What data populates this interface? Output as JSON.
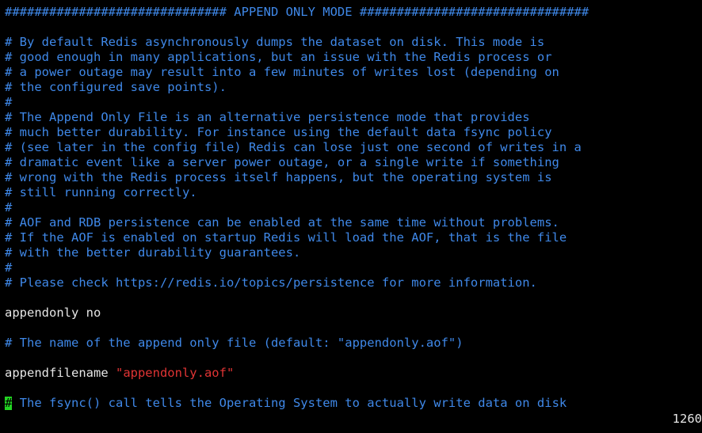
{
  "window": {
    "colors": {
      "background": "#000000",
      "comment": "#3f88e8",
      "text": "#e6e6e6",
      "string": "#e03434",
      "cursor": "#22d422"
    }
  },
  "editor": {
    "header": "############################## APPEND ONLY MODE ###############################",
    "comments": [
      "# By default Redis asynchronously dumps the dataset on disk. This mode is",
      "# good enough in many applications, but an issue with the Redis process or",
      "# a power outage may result into a few minutes of writes lost (depending on",
      "# the configured save points).",
      "#",
      "# The Append Only File is an alternative persistence mode that provides",
      "# much better durability. For instance using the default data fsync policy",
      "# (see later in the config file) Redis can lose just one second of writes in a",
      "# dramatic event like a server power outage, or a single write if something",
      "# wrong with the Redis process itself happens, but the operating system is",
      "# still running correctly.",
      "#",
      "# AOF and RDB persistence can be enabled at the same time without problems.",
      "# If the AOF is enabled on startup Redis will load the AOF, that is the file",
      "# with the better durability guarantees.",
      "#",
      "# Please check https://redis.io/topics/persistence for more information."
    ],
    "appendonly_line": "appendonly no",
    "filename_comment": "# The name of the append only file (default: \"appendonly.aof\")",
    "appendfilename_key": "appendfilename ",
    "appendfilename_value": "\"appendonly.aof\"",
    "cursor_char": "#",
    "last_line_rest": " The fsync() call tells the Operating System to actually write data on disk"
  },
  "status": {
    "line_number": "1260"
  }
}
